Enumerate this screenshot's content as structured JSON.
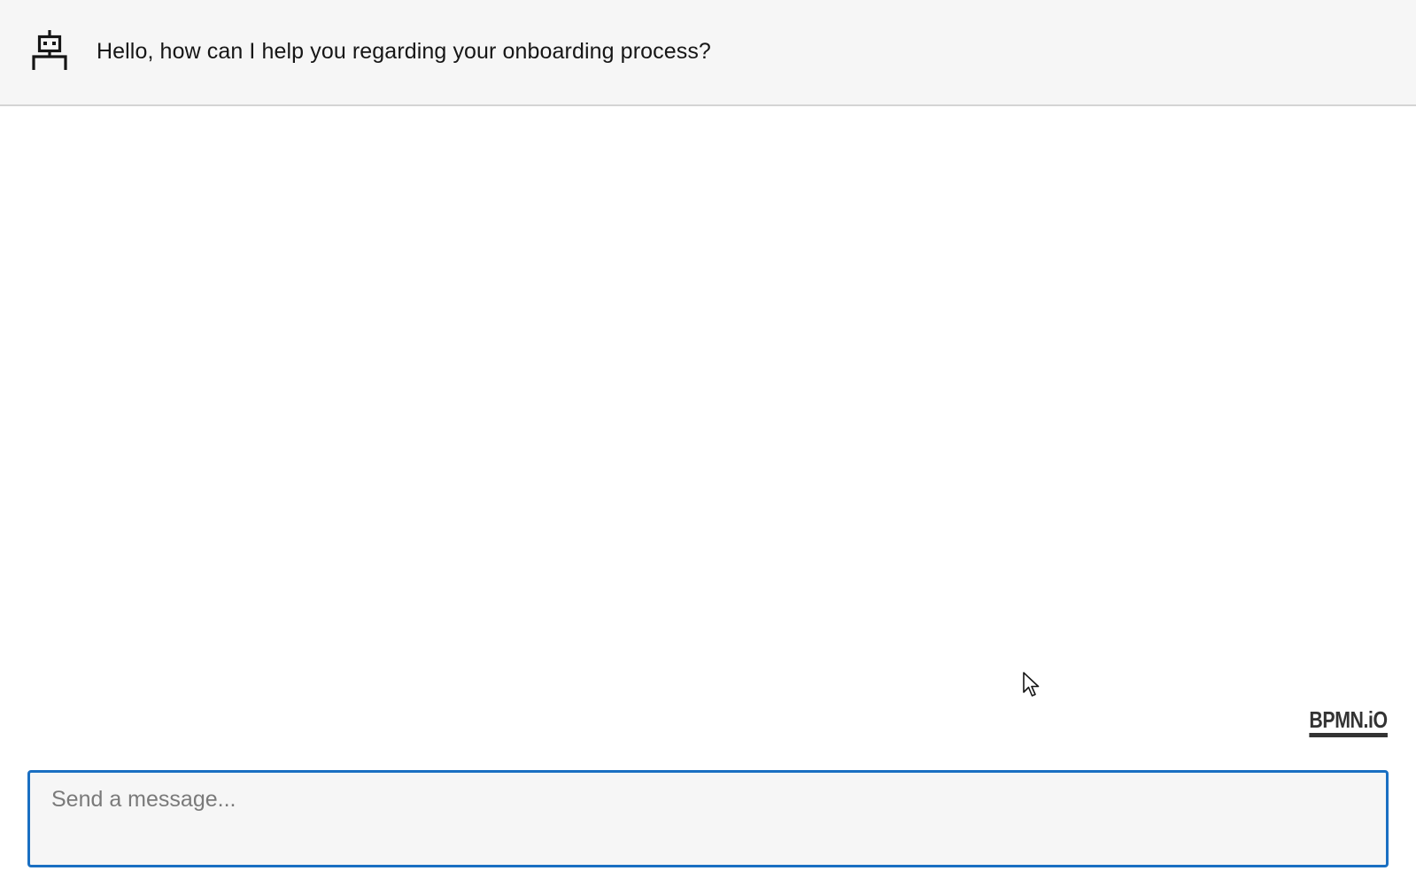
{
  "header": {
    "bot_icon": "robot-icon",
    "greeting": "Hello, how can I help you regarding your onboarding process?"
  },
  "branding": {
    "label": "BPMN.iO"
  },
  "composer": {
    "placeholder": "Send a message...",
    "value": ""
  },
  "colors": {
    "accent": "#1a6fc2",
    "header_bg": "#f6f6f6",
    "text": "#161616",
    "placeholder": "#7a7a7a",
    "brand": "#333333"
  }
}
